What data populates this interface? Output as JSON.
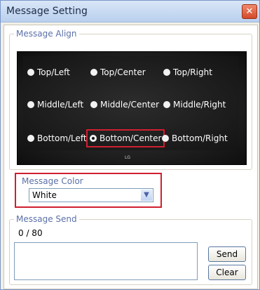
{
  "window": {
    "title": "Message Setting",
    "close_label": "✕"
  },
  "align": {
    "legend": "Message Align",
    "options": [
      {
        "label": "Top/Left",
        "checked": false
      },
      {
        "label": "Top/Center",
        "checked": false
      },
      {
        "label": "Top/Right",
        "checked": false
      },
      {
        "label": "Middle/Left",
        "checked": false
      },
      {
        "label": "Middle/Center",
        "checked": false
      },
      {
        "label": "Middle/Right",
        "checked": false
      },
      {
        "label": "Bottom/Left",
        "checked": false
      },
      {
        "label": "Bottom/Center",
        "checked": true
      },
      {
        "label": "Bottom/Right",
        "checked": false
      }
    ],
    "tv_logo": "LG"
  },
  "color": {
    "legend": "Message Color",
    "selected": "White"
  },
  "send": {
    "legend": "Message Send",
    "counter": "0 / 80",
    "send_label": "Send",
    "clear_label": "Clear"
  },
  "theme": {
    "highlight": "#d01f2f",
    "legend_color": "#5a70a8"
  }
}
